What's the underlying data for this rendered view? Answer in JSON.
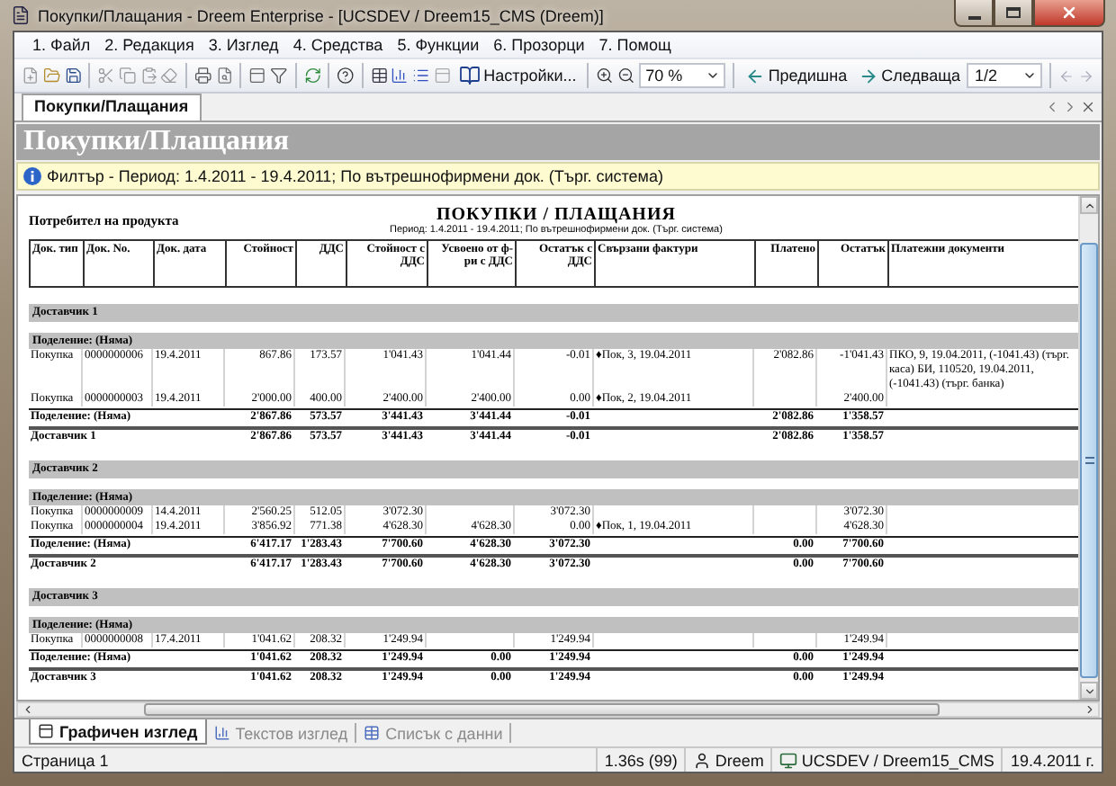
{
  "window": {
    "title": "Покупки/Плащания - Dreem Enterprise - [UCSDEV / Dreem15_CMS (Dreem)]"
  },
  "menu": [
    "1. Файл",
    "2. Редакция",
    "3. Изглед",
    "4. Средства",
    "5. Функции",
    "6. Прозорци",
    "7. Помощ"
  ],
  "toolbar": {
    "settings": "Настройки...",
    "zoom": "70 %",
    "previous": "Предишна",
    "next": "Следваща",
    "page": "1/2"
  },
  "document_tab": {
    "label": "Покупки/Плащания"
  },
  "header": {
    "title": "Покупки/Плащания"
  },
  "filter": "Филтър - Период: 1.4.2011 - 19.4.2011; По вътрешнофирмени док. (Търг. система)",
  "report": {
    "company": "Потребител на продукта",
    "title": "ПОКУПКИ / ПЛАЩАНИЯ",
    "period": "Период: 1.4.2011 - 19.4.2011; По вътрешнофирмени док. (Търг. система)",
    "columns": [
      "Док. тип",
      "Док. No.",
      "Док. дата",
      "Стойност",
      "ДДС",
      "Стойност с ДДС",
      "Усвоено от ф-ри с ДДС",
      "Остатък с ДДС",
      "Свързани фактури",
      "Платено",
      "Остатък",
      "Платежни документи"
    ],
    "groups": [
      {
        "title": "Доставчик 1",
        "subgroups": [
          {
            "title": "Поделение: (Няма)",
            "rows": [
              [
                "Покупка",
                "0000000006",
                "19.4.2011",
                "867.86",
                "173.57",
                "1'041.43",
                "1'041.44",
                "-0.01",
                "♦Пок, 3, 19.04.2011",
                "2'082.86",
                "-1'041.43",
                "ПКО, 9, 19.04.2011, (-1041.43) (търг. каса) БИ, 110520, 19.04.2011, (-1041.43) (търг. банка)"
              ],
              [
                "Покупка",
                "0000000003",
                "19.4.2011",
                "2'000.00",
                "400.00",
                "2'400.00",
                "2'400.00",
                "0.00",
                "♦Пок, 2, 19.04.2011",
                null,
                "2'400.00",
                null
              ]
            ],
            "subtotal": {
              "label": "Поделение: (Няма)",
              "cells": [
                "2'867.86",
                "573.57",
                "3'441.43",
                "3'441.44",
                "-0.01",
                null,
                "2'082.86",
                "1'358.57",
                null
              ]
            }
          }
        ],
        "total": {
          "label": "Доставчик 1",
          "cells": [
            "2'867.86",
            "573.57",
            "3'441.43",
            "3'441.44",
            "-0.01",
            null,
            "2'082.86",
            "1'358.57",
            null
          ]
        }
      },
      {
        "title": "Доставчик 2",
        "subgroups": [
          {
            "title": "Поделение: (Няма)",
            "rows": [
              [
                "Покупка",
                "0000000009",
                "14.4.2011",
                "2'560.25",
                "512.05",
                "3'072.30",
                null,
                "3'072.30",
                null,
                null,
                "3'072.30",
                null
              ],
              [
                "Покупка",
                "0000000004",
                "19.4.2011",
                "3'856.92",
                "771.38",
                "4'628.30",
                "4'628.30",
                "0.00",
                "♦Пок, 1, 19.04.2011",
                null,
                "4'628.30",
                null
              ]
            ],
            "subtotal": {
              "label": "Поделение: (Няма)",
              "cells": [
                "6'417.17",
                "1'283.43",
                "7'700.60",
                "4'628.30",
                "3'072.30",
                null,
                "0.00",
                "7'700.60",
                null
              ]
            }
          }
        ],
        "total": {
          "label": "Доставчик 2",
          "cells": [
            "6'417.17",
            "1'283.43",
            "7'700.60",
            "4'628.30",
            "3'072.30",
            null,
            "0.00",
            "7'700.60",
            null
          ]
        }
      },
      {
        "title": "Доставчик 3",
        "subgroups": [
          {
            "title": "Поделение: (Няма)",
            "rows": [
              [
                "Покупка",
                "0000000008",
                "17.4.2011",
                "1'041.62",
                "208.32",
                "1'249.94",
                null,
                "1'249.94",
                null,
                null,
                "1'249.94",
                null
              ]
            ],
            "subtotal": {
              "label": "Поделение: (Няма)",
              "cells": [
                "1'041.62",
                "208.32",
                "1'249.94",
                "0.00",
                "1'249.94",
                null,
                "0.00",
                "1'249.94",
                null
              ]
            }
          }
        ],
        "total": {
          "label": "Доставчик 3",
          "cells": [
            "1'041.62",
            "208.32",
            "1'249.94",
            "0.00",
            "1'249.94",
            null,
            "0.00",
            "1'249.94",
            null
          ]
        }
      }
    ]
  },
  "view_tabs": [
    {
      "label": "Графичен изглед",
      "selected": true
    },
    {
      "label": "Текстов изглед",
      "selected": false
    },
    {
      "label": "Списък с данни",
      "selected": false
    }
  ],
  "status_bar": {
    "page": "Страница 1",
    "timing": "1.36s (99)",
    "user": "Dreem",
    "database": "UCSDEV / Dreem15_CMS",
    "date": "19.4.2011 г."
  }
}
